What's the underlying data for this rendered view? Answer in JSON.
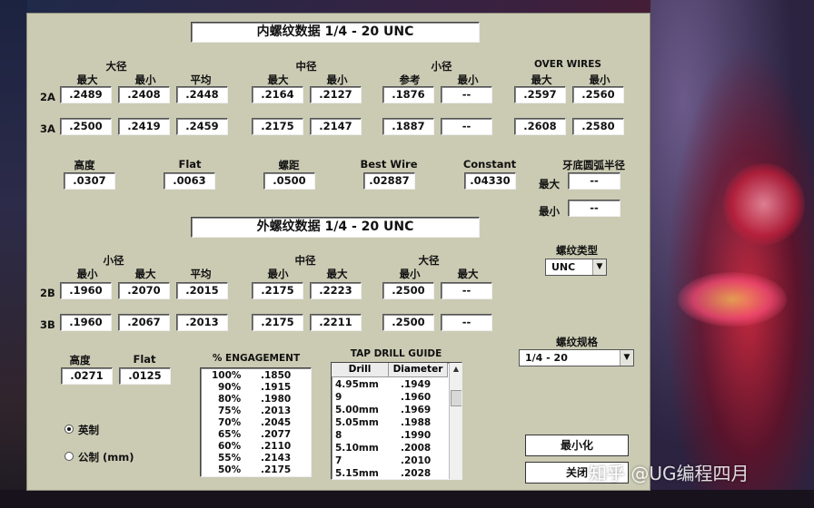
{
  "internal": {
    "title": "内螺纹数据    1/4 - 20   UNC",
    "groups": {
      "major": "大径",
      "pitch": "中径",
      "minor": "小径",
      "over_wires": "OVER WIRES"
    },
    "col": {
      "max": "最大",
      "min": "最小",
      "avg": "平均",
      "ref": "参考"
    },
    "row2A": {
      "label": "2A",
      "major_max": ".2489",
      "major_min": ".2408",
      "major_avg": ".2448",
      "pitch_max": ".2164",
      "pitch_min": ".2127",
      "minor_ref": ".1876",
      "minor_min": "--",
      "ow_max": ".2597",
      "ow_min": ".2560"
    },
    "row3A": {
      "label": "3A",
      "major_max": ".2500",
      "major_min": ".2419",
      "major_avg": ".2459",
      "pitch_max": ".2175",
      "pitch_min": ".2147",
      "minor_ref": ".1887",
      "minor_min": "--",
      "ow_max": ".2608",
      "ow_min": ".2580"
    },
    "height": {
      "label": "高度",
      "value": ".0307"
    },
    "flat": {
      "label": "Flat",
      "value": ".0063"
    },
    "pitch": {
      "label": "螺距",
      "value": ".0500"
    },
    "best_wire": {
      "label": "Best Wire",
      "value": ".02887"
    },
    "constant": {
      "label": "Constant",
      "value": ".04330"
    },
    "root_radius": {
      "label": "牙底圆弧半径",
      "max_label": "最大",
      "max": "--",
      "min_label": "最小",
      "min": "--"
    }
  },
  "external": {
    "title": "外螺纹数据    1/4 - 20   UNC",
    "groups": {
      "minor": "小径",
      "pitch": "中径",
      "major": "大径"
    },
    "col": {
      "min": "最小",
      "max": "最大",
      "avg": "平均"
    },
    "row2B": {
      "label": "2B",
      "minor_min": ".1960",
      "minor_max": ".2070",
      "minor_avg": ".2015",
      "pitch_min": ".2175",
      "pitch_max": ".2223",
      "major_min": ".2500",
      "major_max": "--"
    },
    "row3B": {
      "label": "3B",
      "minor_min": ".1960",
      "minor_max": ".2067",
      "minor_avg": ".2013",
      "pitch_min": ".2175",
      "pitch_max": ".2211",
      "major_min": ".2500",
      "major_max": "--"
    },
    "height": {
      "label": "高度",
      "value": ".0271"
    },
    "flat": {
      "label": "Flat",
      "value": ".0125"
    }
  },
  "engagement": {
    "label": "% ENGAGEMENT",
    "rows": [
      [
        "100%",
        ".1850"
      ],
      [
        "90%",
        ".1915"
      ],
      [
        "80%",
        ".1980"
      ],
      [
        "75%",
        ".2013"
      ],
      [
        "70%",
        ".2045"
      ],
      [
        "65%",
        ".2077"
      ],
      [
        "60%",
        ".2110"
      ],
      [
        "55%",
        ".2143"
      ],
      [
        "50%",
        ".2175"
      ]
    ]
  },
  "tap_drill": {
    "label": "TAP DRILL GUIDE",
    "headers": [
      "Drill",
      "Diameter"
    ],
    "rows": [
      [
        "4.95mm",
        ".1949"
      ],
      [
        "9",
        ".1960"
      ],
      [
        "5.00mm",
        ".1969"
      ],
      [
        "5.05mm",
        ".1988"
      ],
      [
        "8",
        ".1990"
      ],
      [
        "5.10mm",
        ".2008"
      ],
      [
        "7",
        ".2010"
      ],
      [
        "5.15mm",
        ".2028"
      ]
    ]
  },
  "thread_type": {
    "label": "螺纹类型",
    "value": "UNC"
  },
  "thread_spec": {
    "label": "螺纹规格",
    "value": "1/4 - 20"
  },
  "units": {
    "imperial": "英制",
    "metric": "公制 (mm)",
    "selected": "imperial"
  },
  "buttons": {
    "minimize": "最小化",
    "close": "关闭"
  },
  "watermark": "知乎 @UG编程四月",
  "icons": {
    "combo_arrow": "▼",
    "scroll_up": "▲",
    "scroll_down": "▼"
  }
}
